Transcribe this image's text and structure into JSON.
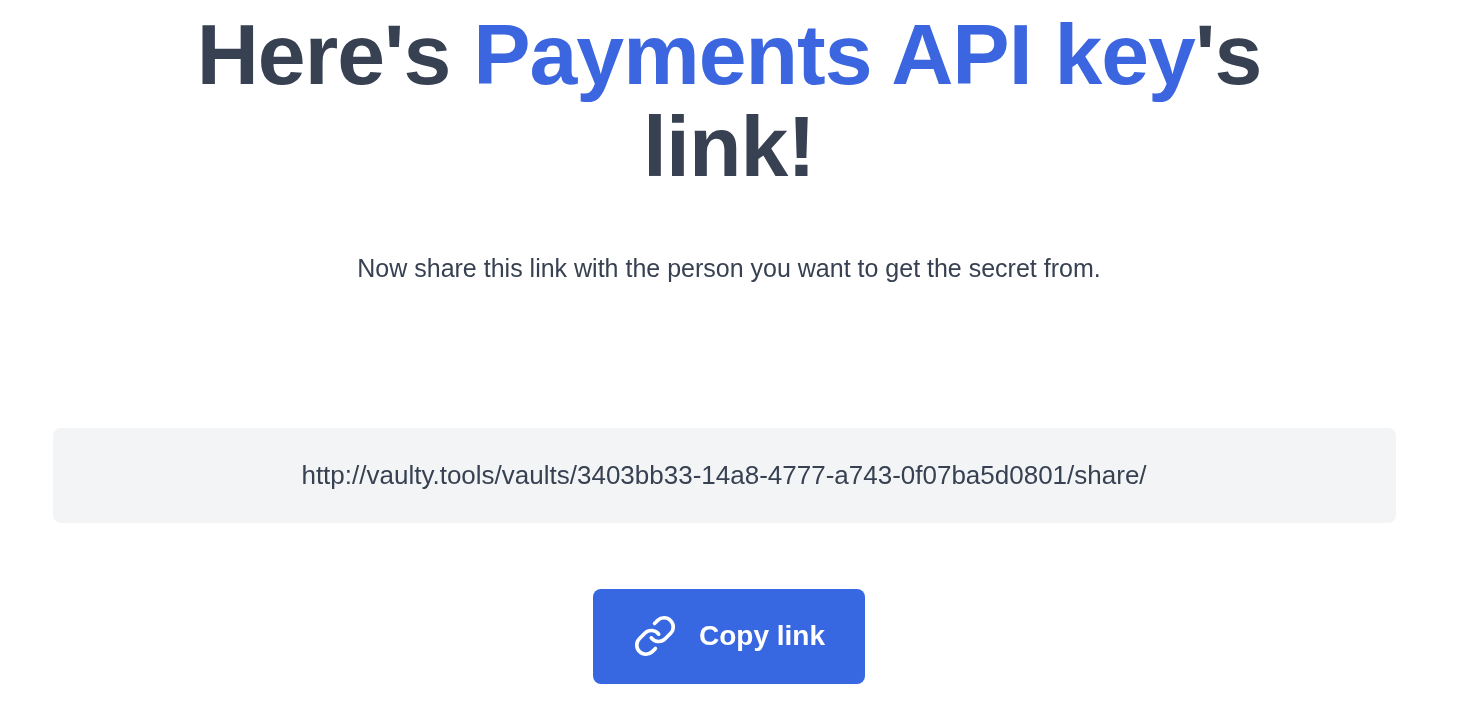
{
  "heading": {
    "before": "Here's ",
    "highlight": "Payments API key",
    "after": "'s link!"
  },
  "subtitle": "Now share this link with the person you want to get the secret from.",
  "share_link": {
    "value": "http://vaulty.tools/vaults/3403bb33-14a8-4777-a743-0f07ba5d0801/share/"
  },
  "copy_button": {
    "label": "Copy link"
  }
}
